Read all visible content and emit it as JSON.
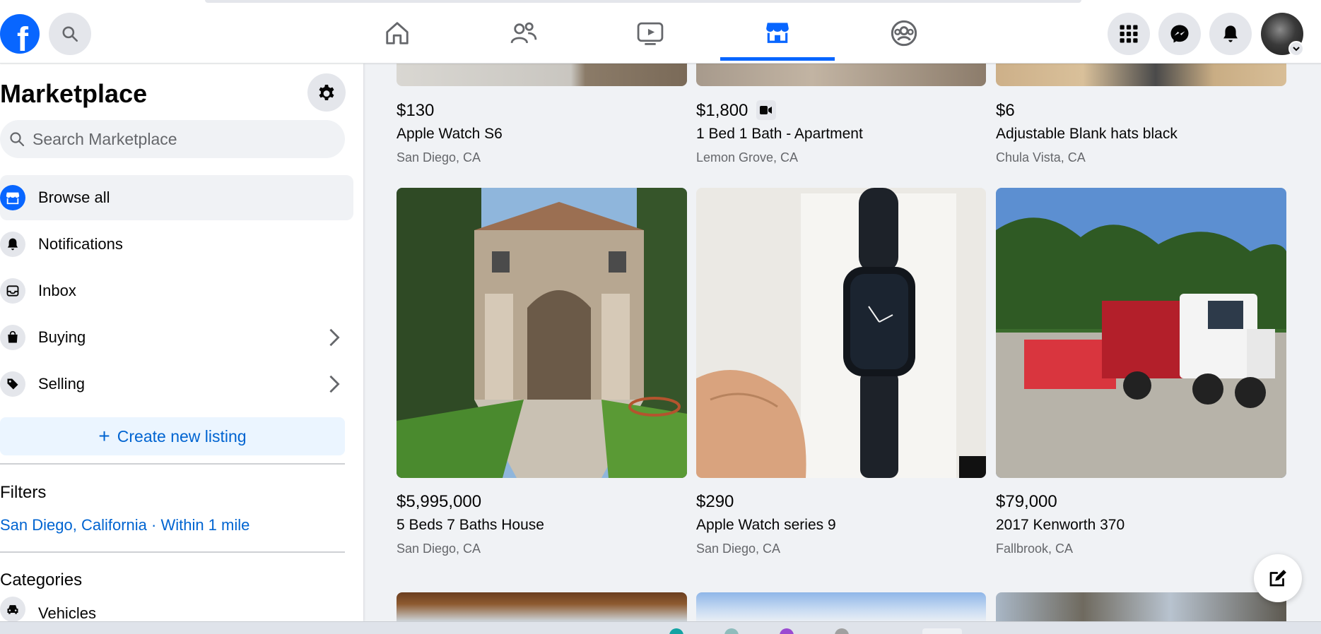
{
  "nav": {
    "logo_letter": "f",
    "tabs": [
      "home",
      "friends",
      "watch",
      "marketplace",
      "groups"
    ],
    "active_tab": "marketplace",
    "right_buttons": [
      "menu-grid",
      "messenger",
      "notifications",
      "account"
    ]
  },
  "sidebar": {
    "title": "Marketplace",
    "search_placeholder": "Search Marketplace",
    "items": [
      {
        "label": "Browse all",
        "icon": "storefront-icon",
        "active": true
      },
      {
        "label": "Notifications",
        "icon": "bell-icon"
      },
      {
        "label": "Inbox",
        "icon": "inbox-icon"
      },
      {
        "label": "Buying",
        "icon": "shopping-bag-icon",
        "has_chevron": true
      },
      {
        "label": "Selling",
        "icon": "price-tag-icon",
        "has_chevron": true
      }
    ],
    "create_label": "Create new listing",
    "filters_title": "Filters",
    "filter_location": "San Diego, California · Within 1 mile",
    "categories_title": "Categories",
    "categories": [
      {
        "label": "Vehicles",
        "icon": "car-icon"
      }
    ]
  },
  "listings_top": [
    {
      "price": "$130",
      "title": "Apple Watch S6",
      "location": "San Diego, CA"
    },
    {
      "price": "$1,800",
      "title": "1 Bed 1 Bath - Apartment",
      "location": "Lemon Grove, CA",
      "has_video": true
    },
    {
      "price": "$6",
      "title": "Adjustable Blank hats black",
      "location": "Chula Vista, CA"
    }
  ],
  "listings_mid": [
    {
      "price": "$5,995,000",
      "title": "5 Beds 7 Baths House",
      "location": "San Diego, CA",
      "image": "mansion-photo"
    },
    {
      "price": "$290",
      "title": "Apple Watch series 9",
      "location": "San Diego, CA",
      "image": "watch-photo"
    },
    {
      "price": "$79,000",
      "title": "2017 Kenworth 370",
      "location": "Fallbrook, CA",
      "image": "truck-photo"
    }
  ],
  "colors": {
    "accent": "#0866ff",
    "link": "#0064d1",
    "bg": "#f0f2f5"
  }
}
